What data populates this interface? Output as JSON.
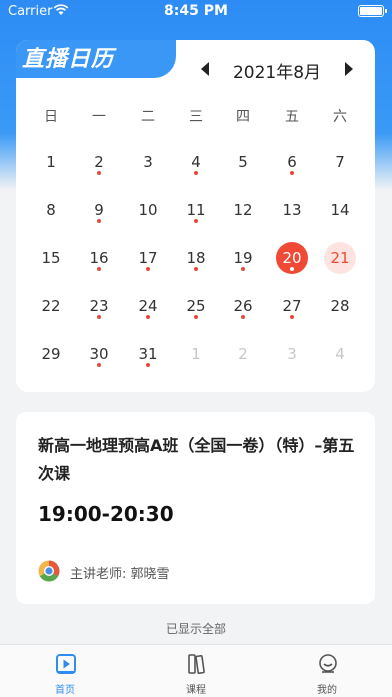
{
  "status_bar": {
    "carrier": "Carrier",
    "time": "8:45 PM"
  },
  "brand": {
    "title": "直播日历"
  },
  "calendar": {
    "month_label": "2021年8月",
    "weekdays": [
      "日",
      "一",
      "二",
      "三",
      "四",
      "五",
      "六"
    ],
    "weeks": [
      [
        {
          "d": "1"
        },
        {
          "d": "2",
          "dot": true
        },
        {
          "d": "3"
        },
        {
          "d": "4",
          "dot": true
        },
        {
          "d": "5"
        },
        {
          "d": "6",
          "dot": true
        },
        {
          "d": "7"
        }
      ],
      [
        {
          "d": "8"
        },
        {
          "d": "9",
          "dot": true
        },
        {
          "d": "10"
        },
        {
          "d": "11",
          "dot": true
        },
        {
          "d": "12"
        },
        {
          "d": "13"
        },
        {
          "d": "14"
        }
      ],
      [
        {
          "d": "15"
        },
        {
          "d": "16",
          "dot": true
        },
        {
          "d": "17",
          "dot": true
        },
        {
          "d": "18",
          "dot": true
        },
        {
          "d": "19",
          "dot": true
        },
        {
          "d": "20",
          "dot": true,
          "state": "selected"
        },
        {
          "d": "21",
          "state": "today"
        }
      ],
      [
        {
          "d": "22"
        },
        {
          "d": "23",
          "dot": true
        },
        {
          "d": "24",
          "dot": true
        },
        {
          "d": "25",
          "dot": true
        },
        {
          "d": "26",
          "dot": true
        },
        {
          "d": "27",
          "dot": true
        },
        {
          "d": "28"
        }
      ],
      [
        {
          "d": "29"
        },
        {
          "d": "30",
          "dot": true
        },
        {
          "d": "31",
          "dot": true
        },
        {
          "d": "1",
          "state": "other"
        },
        {
          "d": "2",
          "state": "other"
        },
        {
          "d": "3",
          "state": "other"
        },
        {
          "d": "4",
          "state": "other"
        }
      ]
    ]
  },
  "lesson": {
    "title": "新高一地理预高A班（全国一卷）（特）–第五次课",
    "time": "19:00-20:30",
    "teacher": "主讲老师: 郭晓雪"
  },
  "end_note": "已显示全部",
  "tabs": [
    {
      "label": "首页",
      "icon": "play-icon",
      "active": true
    },
    {
      "label": "课程",
      "icon": "books-icon",
      "active": false
    },
    {
      "label": "我的",
      "icon": "profile-icon",
      "active": false
    }
  ],
  "colors": {
    "primary": "#2f8cf2",
    "accent_red": "#f04a36",
    "dot_red": "#e8483b"
  }
}
